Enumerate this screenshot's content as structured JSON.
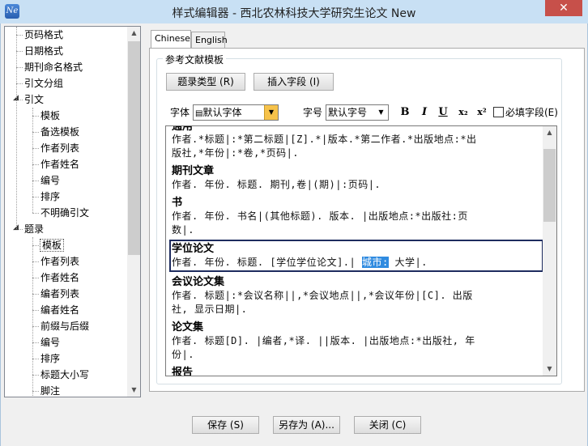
{
  "window": {
    "title": "样式编辑器 - 西北农林科技大学研究生论文 New",
    "icon_text": "Ne",
    "close_glyph": "✕"
  },
  "tree": {
    "items": [
      {
        "label": "页码格式",
        "level": 1,
        "expander": ""
      },
      {
        "label": "日期格式",
        "level": 1,
        "expander": ""
      },
      {
        "label": "期刊命名格式",
        "level": 1,
        "expander": ""
      },
      {
        "label": "引文分组",
        "level": 1,
        "expander": ""
      },
      {
        "label": "引文",
        "level": 1,
        "expander": "◢"
      },
      {
        "label": "模板",
        "level": 2,
        "expander": ""
      },
      {
        "label": "备选模板",
        "level": 2,
        "expander": ""
      },
      {
        "label": "作者列表",
        "level": 2,
        "expander": ""
      },
      {
        "label": "作者姓名",
        "level": 2,
        "expander": ""
      },
      {
        "label": "编号",
        "level": 2,
        "expander": ""
      },
      {
        "label": "排序",
        "level": 2,
        "expander": ""
      },
      {
        "label": "不明确引文",
        "level": 2,
        "expander": ""
      },
      {
        "label": "题录",
        "level": 1,
        "expander": "◢"
      },
      {
        "label": "模板",
        "level": 2,
        "expander": "",
        "selected": true
      },
      {
        "label": "作者列表",
        "level": 2,
        "expander": ""
      },
      {
        "label": "作者姓名",
        "level": 2,
        "expander": ""
      },
      {
        "label": "编者列表",
        "level": 2,
        "expander": ""
      },
      {
        "label": "编者姓名",
        "level": 2,
        "expander": ""
      },
      {
        "label": "前缀与后缀",
        "level": 2,
        "expander": ""
      },
      {
        "label": "编号",
        "level": 2,
        "expander": ""
      },
      {
        "label": "排序",
        "level": 2,
        "expander": ""
      },
      {
        "label": "标题大小写",
        "level": 2,
        "expander": ""
      },
      {
        "label": "脚注",
        "level": 2,
        "expander": ""
      }
    ]
  },
  "tabs": [
    {
      "label": "Chinese",
      "active": true
    },
    {
      "label": "English",
      "active": false
    }
  ],
  "group": {
    "label": "参考文献模板",
    "ref_type_button": "题录类型 (R)",
    "insert_field_button": "插入字段 (I)"
  },
  "toolbar": {
    "font_label": "字体",
    "font_value": "默认字体",
    "size_label": "字号",
    "size_value": "默认字号",
    "bold": "B",
    "italic": "I",
    "underline": "U",
    "subscript": "x₂",
    "superscript": "x²",
    "required_field_label": "必填字段(E)"
  },
  "editor": {
    "top_partial": "通用",
    "entries": [
      {
        "head": "",
        "lines": [
          "作者.*标题|:*第二标题|[Z].*|版本.*第二作者.*出版地点:*出",
          "版社,*年份|:*卷,*页码|."
        ]
      },
      {
        "head": "期刊文章",
        "lines": [
          "作者. 年份. 标题. 期刊,卷|(期)|:页码|."
        ]
      },
      {
        "head": "书",
        "lines": [
          "作者. 年份. 书名|(其他标题). 版本. |出版地点:*出版社:页",
          "数|."
        ]
      },
      {
        "head": "学位论文",
        "lines_parts": [
          "作者. 年份. 标题. [学位学位论文].| ",
          "城市:",
          " 大学|."
        ],
        "selected": true
      },
      {
        "head": "会议论文集",
        "lines": [
          "作者. 标题|:*会议名称||,*会议地点||,*会议年份|[C]. 出版",
          "社, 显示日期|."
        ]
      },
      {
        "head": "论文集",
        "lines": [
          "作者. 标题[D]. |编者,*译. ||版本. |出版地点:*出版社, 年",
          "份|."
        ]
      },
      {
        "head": "报告",
        "lines": []
      }
    ]
  },
  "buttons": {
    "save": "保存 (S)",
    "save_as": "另存为 (A)...",
    "close": "关闭 (C)"
  },
  "colors": {
    "selection_border": "#1e2c5f",
    "highlight": "#2f8be0",
    "close_button": "#c7504a"
  }
}
